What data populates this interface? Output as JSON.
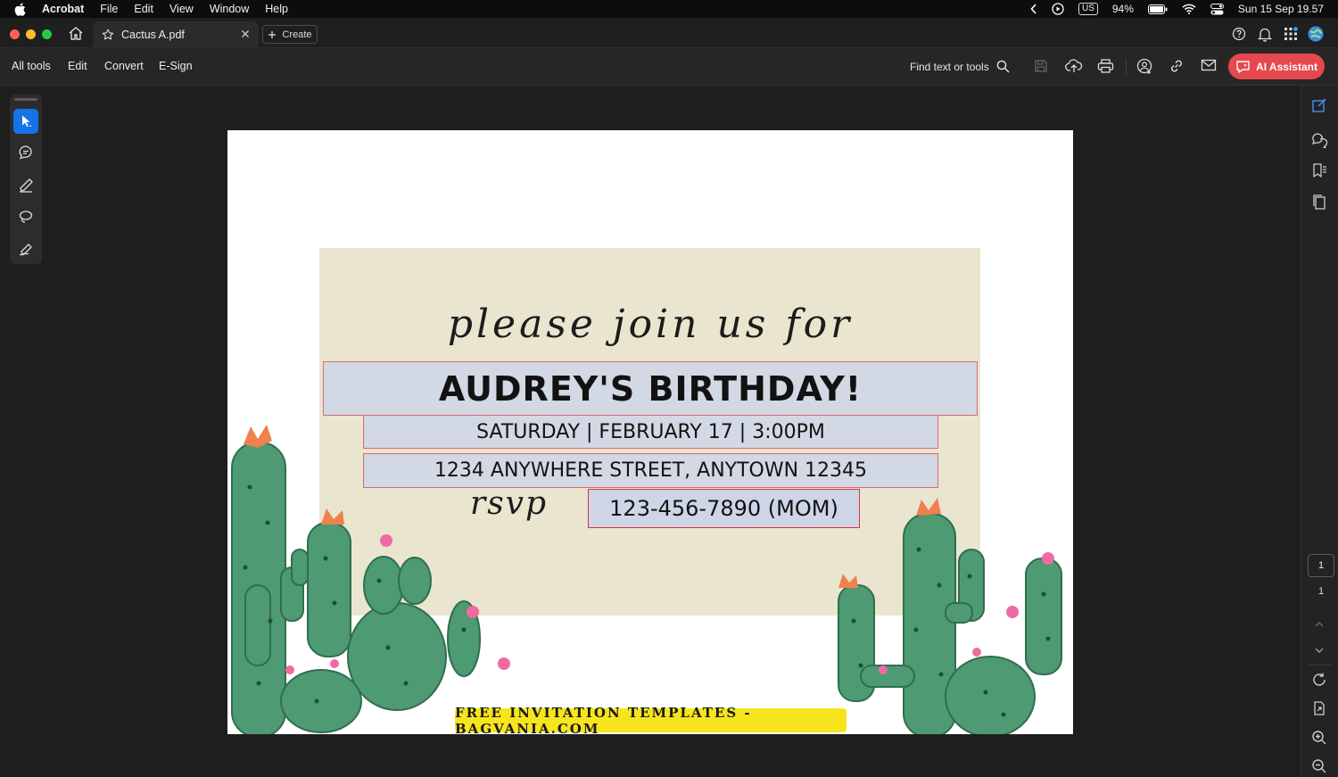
{
  "menubar": {
    "app_name": "Acrobat",
    "menus": [
      "File",
      "Edit",
      "View",
      "Window",
      "Help"
    ],
    "status": {
      "input_source": "US",
      "battery": "94%",
      "datetime": "Sun 15 Sep  19.57"
    }
  },
  "tabbar": {
    "tab_title": "Cactus A.pdf",
    "create_label": "Create"
  },
  "toolbar": {
    "menu": [
      "All tools",
      "Edit",
      "Convert",
      "E-Sign"
    ],
    "find_label": "Find text or tools",
    "ai_assistant_label": "AI Assistant"
  },
  "pager": {
    "current_page": "1",
    "total_pages": "1"
  },
  "document": {
    "script_heading": "please join us for",
    "name_field": "AUDREY'S BIRTHDAY!",
    "date_field": "SATURDAY | FEBRUARY 17 | 3:00PM",
    "address_field": "1234 ANYWHERE STREET, ANYTOWN 12345",
    "rsvp_script": "rsvp",
    "phone_field": "123-456-7890 (MOM)",
    "footer_banner": "FREE INVITATION TEMPLATES - BAGVANIA.COM"
  },
  "colors": {
    "accent_blue": "#1473e6",
    "ai_button": "#e5484d",
    "form_field_border": "#d86a78",
    "beige_panel": "#eae5cf",
    "banner_yellow": "#f6e51d"
  }
}
